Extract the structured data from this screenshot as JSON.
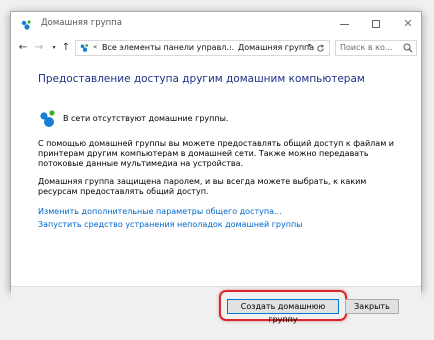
{
  "window": {
    "title": "Домашняя группа",
    "controls": {
      "minimize": "minimize",
      "maximize": "maximize",
      "close": "✕"
    }
  },
  "nav": {
    "back": "←",
    "forward": "→",
    "dropdown": "▾",
    "up": "↑",
    "address": {
      "overflow": "«",
      "segments": [
        "Все элементы панели управл...",
        "Домашняя группа"
      ],
      "separator": "›"
    },
    "search_placeholder": "Поиск в ко..."
  },
  "main": {
    "heading": "Предоставление доступа другим домашним компьютерам",
    "status": "В сети отсутствуют домашние группы.",
    "paragraph1": "С помощью домашней группы вы можете предоставлять общий доступ к файлам и принтерам другим компьютерам в домашней сети. Также можно передавать потоковые данные мультимедиа на устройства.",
    "paragraph2": "Домашняя группа защищена паролем, и вы всегда можете выбрать, к каким ресурсам предоставлять общий доступ.",
    "link_advanced": "Изменить дополнительные параметры общего доступа...",
    "link_troubleshoot": "Запустить средство устранения неполадок домашней группы"
  },
  "footer": {
    "create_button": "Создать домашнюю группу",
    "close_button": "Закрыть"
  },
  "colors": {
    "heading": "#1e3287",
    "link": "#0066cc",
    "highlight": "#d7282f",
    "homegroup_blue": "#1a7fd4",
    "homegroup_green": "#3fae2a"
  },
  "icons": [
    "homegroup-icon",
    "back-arrow-icon",
    "forward-arrow-icon",
    "up-arrow-icon",
    "refresh-icon",
    "search-icon"
  ]
}
